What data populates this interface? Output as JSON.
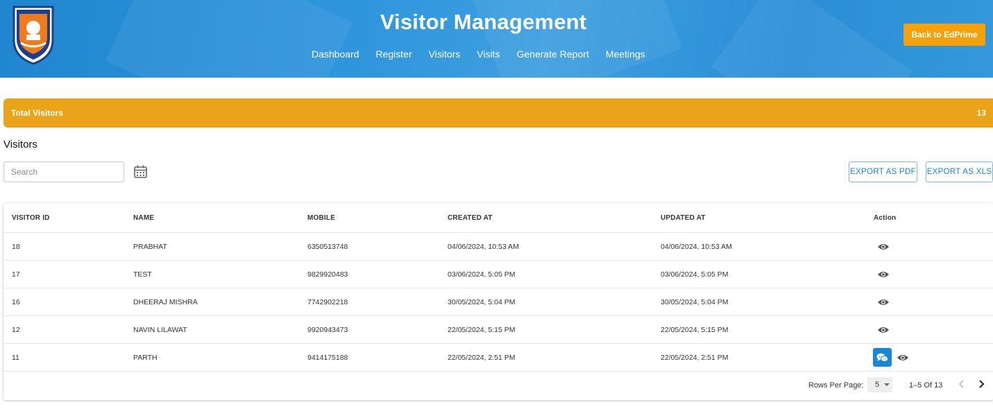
{
  "header": {
    "title": "Visitor Management",
    "nav": [
      "Dashboard",
      "Register",
      "Visitors",
      "Visits",
      "Generate Report",
      "Meetings"
    ],
    "back_button": "Back to EdPrime",
    "logo_icon": "school-emblem-logo"
  },
  "summary": {
    "label": "Total Visitors",
    "count": "13"
  },
  "section_title": "Visitors",
  "search": {
    "placeholder": "Search"
  },
  "exports": {
    "pdf": "EXPORT AS PDF",
    "xls": "EXPORT AS XLS"
  },
  "table": {
    "columns": [
      "VISITOR ID",
      "NAME",
      "MOBILE",
      "CREATED AT",
      "UPDATED AT",
      "Action"
    ],
    "rows": [
      {
        "id": "18",
        "name": "PRABHAT",
        "mobile": "6350513748",
        "created": "04/06/2024, 10:53 AM",
        "updated": "04/06/2024, 10:53 AM",
        "chat": false
      },
      {
        "id": "17",
        "name": "TEST",
        "mobile": "9829920483",
        "created": "03/06/2024, 5:05 PM",
        "updated": "03/06/2024, 5:05 PM",
        "chat": false
      },
      {
        "id": "16",
        "name": "DHEERAJ MISHRA",
        "mobile": "7742902218",
        "created": "30/05/2024, 5:04 PM",
        "updated": "30/05/2024, 5:04 PM",
        "chat": false
      },
      {
        "id": "12",
        "name": "NAVIN LILAWAT",
        "mobile": "9920943473",
        "created": "22/05/2024, 5:15 PM",
        "updated": "22/05/2024, 5:15 PM",
        "chat": false
      },
      {
        "id": "11",
        "name": "PARTH",
        "mobile": "9414175188",
        "created": "22/05/2024, 2:51 PM",
        "updated": "22/05/2024, 2:51 PM",
        "chat": true
      }
    ]
  },
  "pagination": {
    "rows_per_page_label": "Rows Per Page:",
    "rows_per_page": "5",
    "range": "1–5 Of 13"
  },
  "colors": {
    "header_blue": "#2f95dc",
    "accent_orange": "#eba31a",
    "button_orange": "#f5a20a",
    "link_blue": "#1a86d6"
  }
}
